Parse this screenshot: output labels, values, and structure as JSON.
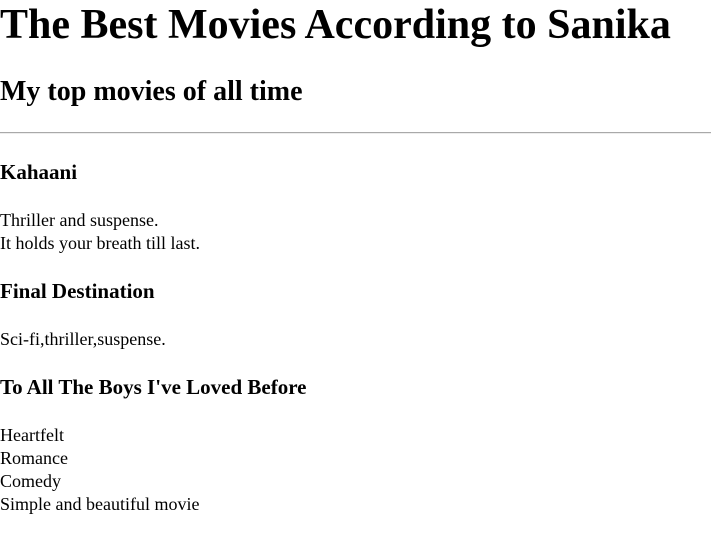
{
  "page": {
    "title": "The Best Movies According to Sanika",
    "subtitle": "My top movies of all time"
  },
  "movies": [
    {
      "name": "Kahaani",
      "lines": [
        "Thriller and suspense.",
        "It holds your breath till last."
      ]
    },
    {
      "name": "Final Destination",
      "lines": [
        "Sci-fi,thriller,suspense."
      ]
    },
    {
      "name": "To All The Boys I've Loved Before",
      "lines": [
        "Heartfelt",
        "Romance",
        "Comedy",
        "Simple and beautiful movie"
      ]
    }
  ]
}
